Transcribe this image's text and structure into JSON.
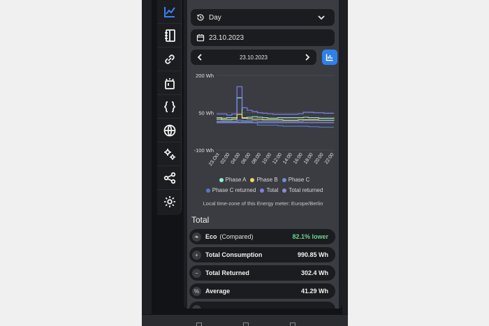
{
  "dropdown": {
    "range_label": "Day",
    "date_value": "23.10.2023"
  },
  "date_nav": {
    "label": "23.10.2023"
  },
  "chart_data": {
    "type": "line",
    "y_ticks": [
      "200 Wh",
      "50 Wh",
      "-100 Wh"
    ],
    "ylim": [
      -100,
      200
    ],
    "x_ticks": [
      "23.Oct",
      "02:00",
      "04:00",
      "06:00",
      "08:00",
      "10:00",
      "12:00",
      "14:00",
      "16:00",
      "18:00",
      "20:00",
      "22:00"
    ],
    "x": [
      0,
      1,
      2,
      3,
      4,
      5,
      6,
      7,
      8,
      9,
      10,
      11,
      12,
      13,
      14,
      15,
      16,
      17,
      18,
      19,
      20,
      21,
      22,
      23
    ],
    "series": [
      {
        "name": "Phase A",
        "color": "#8ef0d2",
        "values": [
          30,
          28,
          30,
          30,
          110,
          30,
          32,
          34,
          32,
          30,
          28,
          28,
          30,
          30,
          30,
          30,
          30,
          32,
          30,
          30,
          28,
          28,
          28,
          30
        ]
      },
      {
        "name": "Phase B",
        "color": "#f1d36b",
        "values": [
          24,
          22,
          22,
          24,
          44,
          28,
          26,
          24,
          24,
          22,
          22,
          22,
          22,
          20,
          20,
          20,
          22,
          22,
          22,
          22,
          20,
          20,
          20,
          22
        ]
      },
      {
        "name": "Phase C",
        "color": "#6d8fd6",
        "values": [
          16,
          16,
          16,
          16,
          20,
          18,
          18,
          18,
          16,
          16,
          16,
          16,
          16,
          16,
          16,
          16,
          16,
          18,
          18,
          18,
          18,
          18,
          18,
          18
        ]
      },
      {
        "name": "Phase C returned",
        "color": "#5579c9",
        "values": [
          14,
          14,
          14,
          14,
          14,
          14,
          14,
          10,
          0,
          0,
          0,
          0,
          -2,
          -4,
          -4,
          -4,
          -4,
          -4,
          -6,
          -6,
          -8,
          -8,
          -8,
          -8
        ]
      },
      {
        "name": "Total",
        "color": "#7d7cf2",
        "values": [
          45,
          45,
          40,
          45,
          155,
          70,
          60,
          55,
          50,
          48,
          46,
          44,
          44,
          44,
          44,
          44,
          46,
          52,
          52,
          50,
          50,
          48,
          48,
          48
        ]
      },
      {
        "name": "Total returned",
        "color": "#8a8ad8",
        "values": [
          10,
          10,
          10,
          10,
          10,
          10,
          10,
          10,
          10,
          10,
          10,
          10,
          10,
          10,
          10,
          10,
          10,
          10,
          10,
          10,
          10,
          10,
          10,
          10
        ]
      }
    ]
  },
  "legend": [
    "Phase A",
    "Phase B",
    "Phase C",
    "Phase C returned",
    "Total",
    "Total returned"
  ],
  "tz_note": "Local time-zone of this Energy meter: Europe/Berlin",
  "total": {
    "title": "Total",
    "rows": [
      {
        "label": "Eco",
        "sub": "(Compared)",
        "value": "82.1% lower",
        "icon": "leaf-icon"
      },
      {
        "label": "Total Consumption",
        "value": "990.85 Wh",
        "icon": "plus-icon"
      },
      {
        "label": "Total Returned",
        "value": "302.4 Wh",
        "icon": "minus-icon"
      },
      {
        "label": "Average",
        "value": "41.29 Wh",
        "icon": "percent-icon"
      }
    ]
  }
}
